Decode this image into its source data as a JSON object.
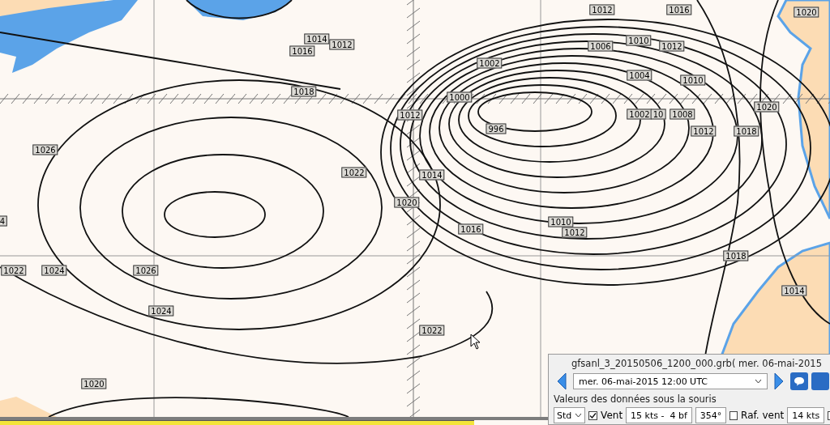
{
  "map": {
    "isobar_labels": [
      "1012",
      "1016",
      "1020",
      "1014",
      "1012",
      "1016",
      "1006",
      "1010",
      "1012",
      "1002",
      "1004",
      "1010",
      "1018",
      "1000",
      "1012",
      "1002",
      "10",
      "1008",
      "1020",
      "996",
      "1012",
      "1018",
      "1026",
      "1022",
      "1014",
      "1020",
      "1010",
      "1016",
      "1012",
      "4",
      "1018",
      "1022",
      "1024",
      "1026",
      "1014",
      "1024",
      "1022",
      "1020"
    ]
  },
  "panel": {
    "title": "gfsanl_3_20150506_1200_000.grb( mer. 06-mai-2015",
    "date_select": {
      "value": "mer. 06-mai-2015 12:00  UTC"
    },
    "section_label": "Valeurs des données sous la souris",
    "mode_select": {
      "value": "Std"
    },
    "wind": {
      "label": "Vent",
      "checked": true,
      "speed": "15 kts -  4 bf",
      "direction": "354°"
    },
    "gust": {
      "label": "Raf. vent",
      "checked": false,
      "speed": "14 kts"
    },
    "extra_option": {
      "checked": false
    }
  }
}
